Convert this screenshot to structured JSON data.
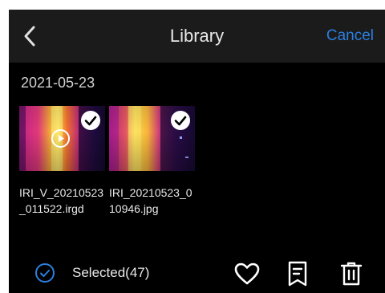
{
  "header": {
    "title": "Library",
    "cancel_label": "Cancel",
    "back_icon": "chevron-left-icon"
  },
  "group": {
    "date": "2021-05-23",
    "items": [
      {
        "filename": "IRI_V_20210523_011522.irgd",
        "type": "video",
        "selected": true
      },
      {
        "filename": "IRI_20210523_010946.jpg",
        "type": "image",
        "selected": true
      }
    ]
  },
  "bottom_bar": {
    "selected_label": "Selected(47)",
    "icons": [
      "check-circle-icon",
      "heart-icon",
      "note-icon",
      "trash-icon"
    ]
  },
  "colors": {
    "background": "#000000",
    "header_bg": "#1b1b1b",
    "accent": "#2c7fe0",
    "text": "#e8e8e8"
  }
}
